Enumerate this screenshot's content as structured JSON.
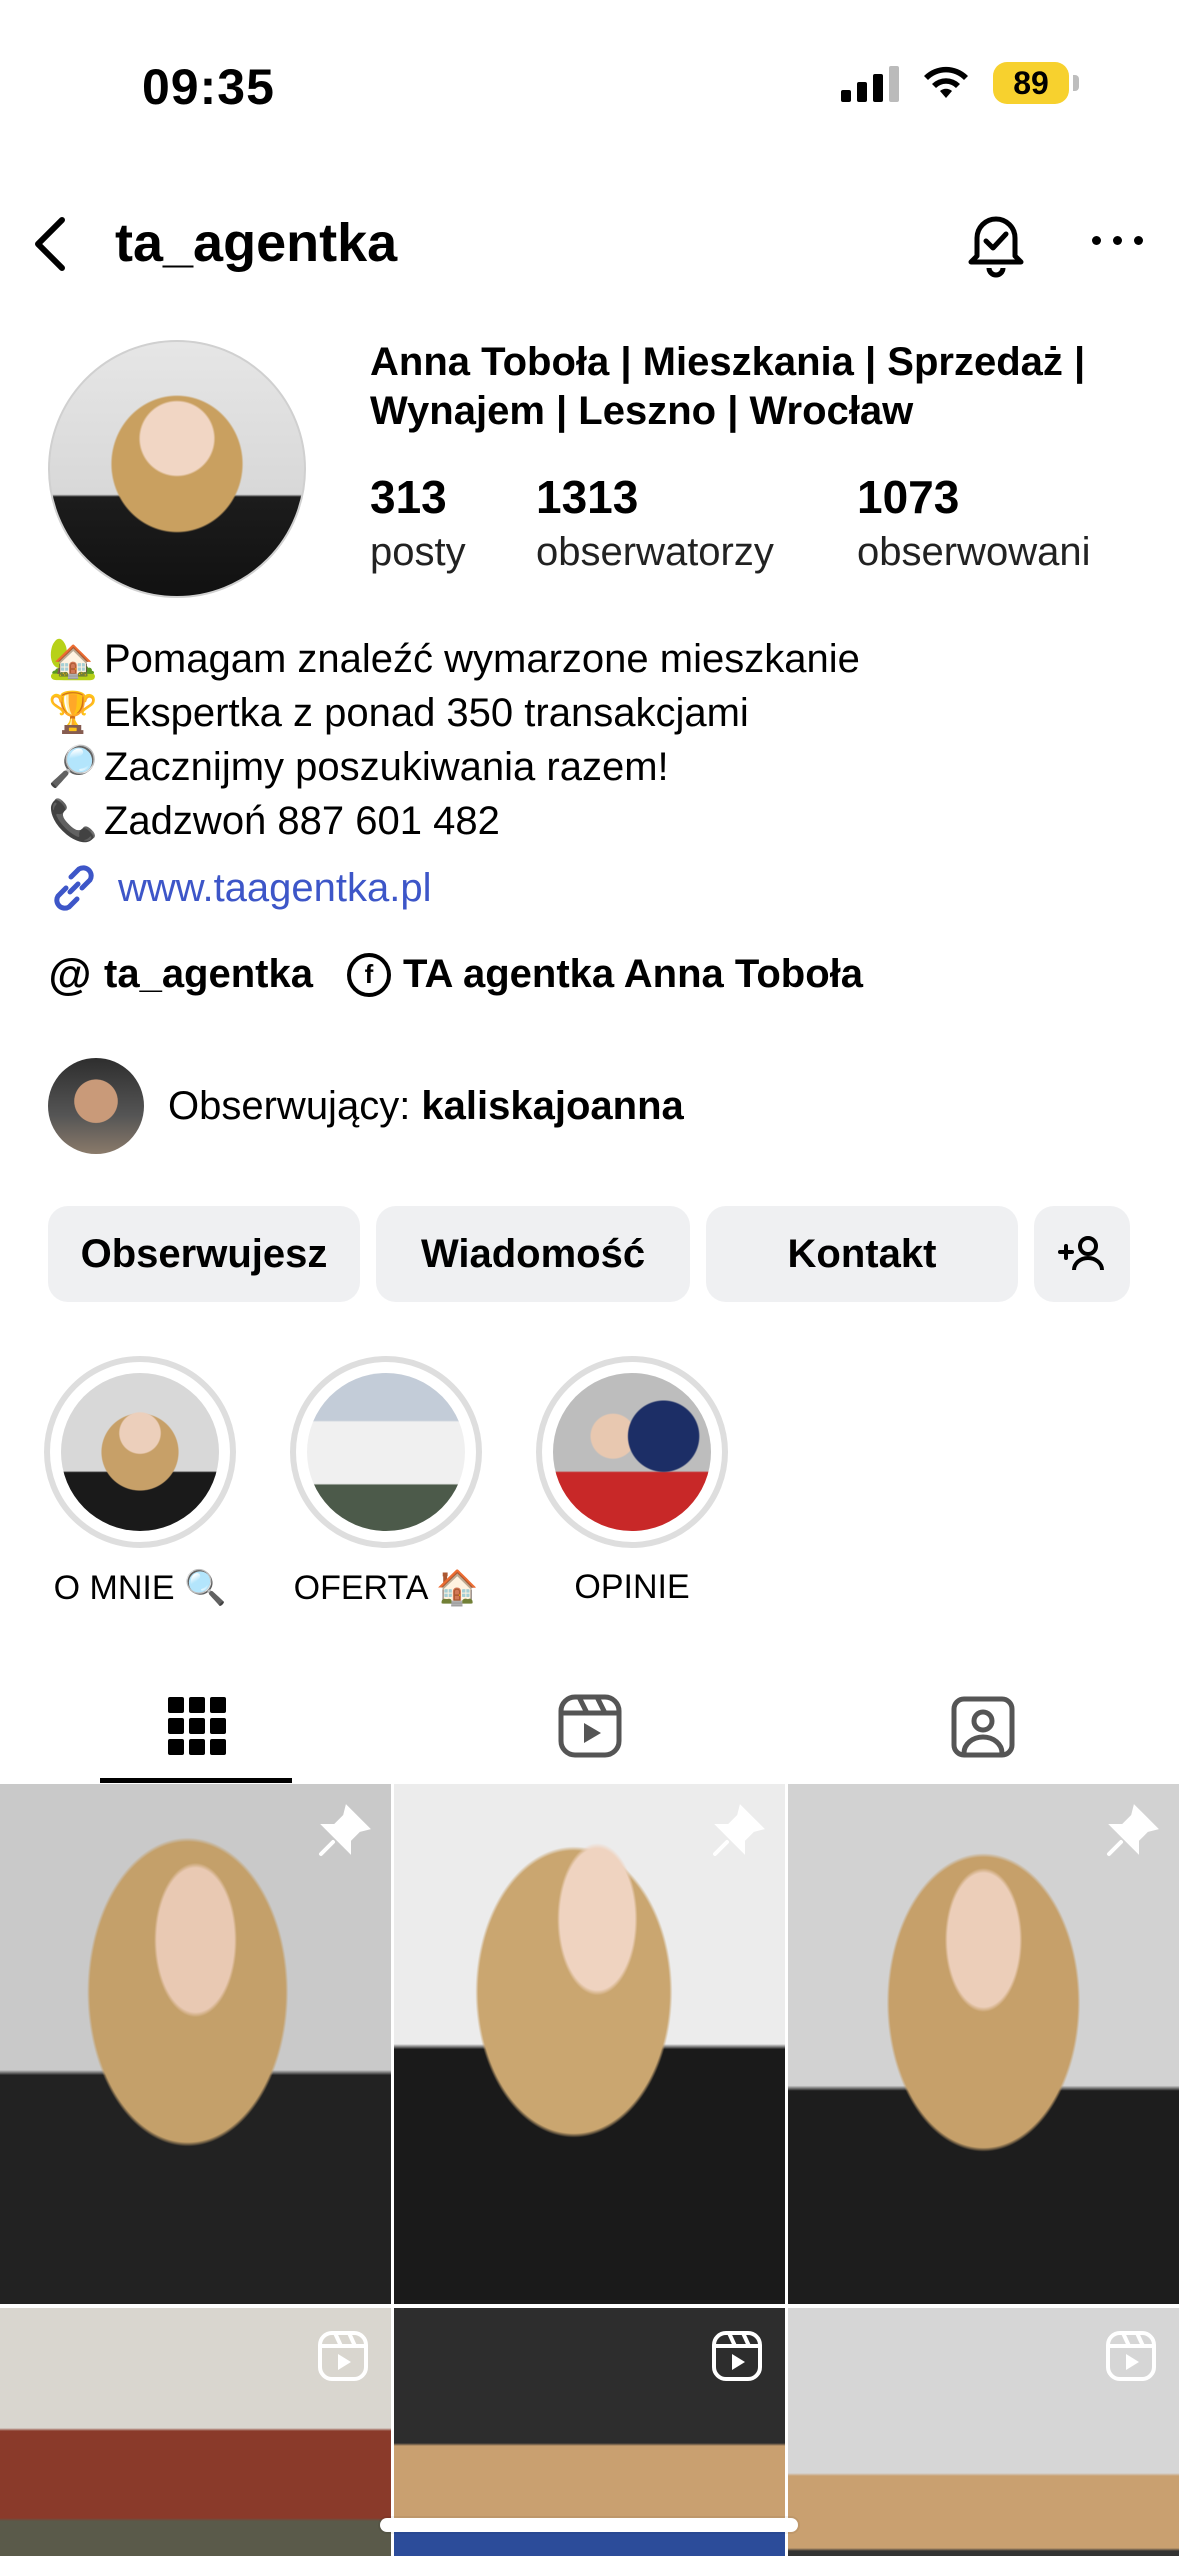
{
  "status_bar": {
    "time": "09:35",
    "battery": "89"
  },
  "header": {
    "username": "ta_agentka"
  },
  "profile": {
    "display_name_line1": "Anna Toboła | Mieszkania | Sprzedaż |",
    "display_name_line2": "Wynajem | Leszno | Wrocław",
    "stats": [
      {
        "value": "313",
        "label": "posty"
      },
      {
        "value": "1313",
        "label": "obserwatorzy"
      },
      {
        "value": "1073",
        "label": "obserwowani"
      }
    ],
    "bio": [
      {
        "emoji": "🏡",
        "text": "Pomagam znaleźć wymarzone mieszkanie"
      },
      {
        "emoji": "🏆",
        "text": "Ekspertka z ponad 350 transakcjami"
      },
      {
        "emoji": "🔎",
        "text": "Zacznijmy poszukiwania razem!"
      },
      {
        "emoji": "📞",
        "text": "Zadzwoń 887 601 482"
      }
    ],
    "website": "www.taagentka.pl",
    "threads": "ta_agentka",
    "facebook": "TA agentka Anna Toboła",
    "followed_by_prefix": "Obserwujący: ",
    "followed_by_user": "kaliskajoanna"
  },
  "buttons": {
    "follow": "Obserwujesz",
    "message": "Wiadomość",
    "contact": "Kontakt"
  },
  "highlights": [
    {
      "label": "O MNIE 🔍"
    },
    {
      "label": "OFERTA 🏠"
    },
    {
      "label": "OPINIE"
    }
  ],
  "colors": {
    "link": "#3d56c8",
    "button_bg": "#eff0f2",
    "battery": "#f7d12e"
  },
  "icons": [
    "back-icon",
    "bell-check-icon",
    "more-icon",
    "link-icon",
    "threads-icon",
    "facebook-icon",
    "add-person-icon",
    "grid-icon",
    "reels-icon",
    "tagged-icon",
    "pin-icon",
    "reel-badge-icon"
  ]
}
